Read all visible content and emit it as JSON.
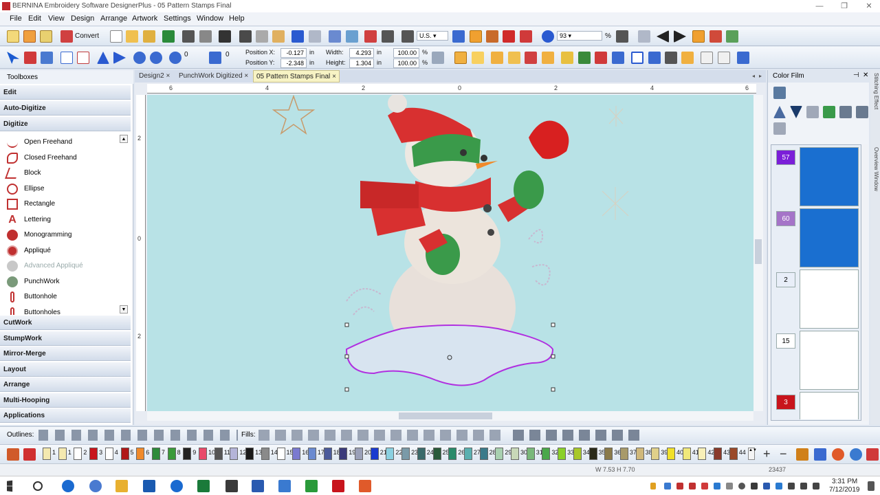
{
  "window": {
    "title": "BERNINA Embroidery Software DesignerPlus - 05 Pattern Stamps Final"
  },
  "menu": [
    "File",
    "Edit",
    "View",
    "Design",
    "Arrange",
    "Artwork",
    "Settings",
    "Window",
    "Help"
  ],
  "toolbar": {
    "convert_label": "Convert",
    "units": "U.S.",
    "zoom": "93",
    "zoom_unit": "%",
    "rotate_value": "0",
    "mirror_value": "0",
    "position_x_label": "Position X:",
    "position_x": "-0.127",
    "position_y_label": "Position Y:",
    "position_y": "-2.348",
    "unit_in": "in",
    "width_label": "Width:",
    "width": "4.293",
    "height_label": "Height:",
    "height": "1.304",
    "scale_x": "100.00",
    "scale_y": "100.00",
    "pct": "%"
  },
  "tabs": [
    {
      "label": "Design2",
      "close": "×"
    },
    {
      "label": "PunchWork Digitized",
      "close": "×"
    },
    {
      "label": "05 Pattern Stamps Final",
      "close": "×"
    }
  ],
  "toolboxes": {
    "title": "Toolboxes",
    "sections_top": [
      "Edit",
      "Auto-Digitize",
      "Digitize"
    ],
    "digitize_items": [
      {
        "label": "Open Freehand",
        "icon": "open-freehand-icon"
      },
      {
        "label": "Closed Freehand",
        "icon": "closed-freehand-icon"
      },
      {
        "label": "Block",
        "icon": "block-icon"
      },
      {
        "label": "Ellipse",
        "icon": "ellipse-icon"
      },
      {
        "label": "Rectangle",
        "icon": "rectangle-icon"
      },
      {
        "label": "Lettering",
        "icon": "lettering-icon"
      },
      {
        "label": "Monogramming",
        "icon": "monogramming-icon"
      },
      {
        "label": "Appliqué",
        "icon": "applique-icon"
      },
      {
        "label": "Advanced Appliqué",
        "icon": "advanced-applique-icon"
      },
      {
        "label": "PunchWork",
        "icon": "punchwork-icon"
      },
      {
        "label": "Buttonhole",
        "icon": "buttonhole-icon"
      },
      {
        "label": "Buttonholes",
        "icon": "buttonholes-icon"
      }
    ],
    "sections_bottom": [
      "CutWork",
      "StumpWork",
      "Mirror-Merge",
      "Layout",
      "Arrange",
      "Multi-Hooping",
      "Applications"
    ]
  },
  "rulers": {
    "h_ticks": [
      "6",
      "4",
      "2",
      "0",
      "2",
      "4",
      "6"
    ],
    "v_ticks": [
      "2",
      "0",
      "2"
    ]
  },
  "colorfilm": {
    "title": "Color Film",
    "side_tabs": [
      "Stitching Effect",
      "Overview Window"
    ],
    "rows": [
      {
        "num": "57",
        "color": "#7b1fd8",
        "thumb": "#1a6fd0"
      },
      {
        "num": "60",
        "color": "#a574c8",
        "thumb": "#1a6fd0"
      },
      {
        "num": "2",
        "color": "#e8eef8",
        "thumb": "#ffffff"
      },
      {
        "num": "15",
        "color": "#ffffff",
        "thumb": "#ffffff"
      },
      {
        "num": "3",
        "color": "#c8141c",
        "thumb": "#ffffff"
      }
    ]
  },
  "bottom": {
    "outlines_label": "Outlines:",
    "fills_label": "Fills:",
    "palette": [
      {
        "n": "1",
        "c": "#f4e9b0"
      },
      {
        "n": "1",
        "c": "#f4e9b0"
      },
      {
        "n": "2",
        "c": "#ffffff"
      },
      {
        "n": "3",
        "c": "#c8141c"
      },
      {
        "n": "4",
        "c": "#ffffff"
      },
      {
        "n": "5",
        "c": "#b01818"
      },
      {
        "n": "6",
        "c": "#f08a2a"
      },
      {
        "n": "7",
        "c": "#2e8b3a"
      },
      {
        "n": "8",
        "c": "#3a9a3a"
      },
      {
        "n": "9",
        "c": "#222222"
      },
      {
        "n": "10",
        "c": "#e84a6a"
      },
      {
        "n": "11",
        "c": "#555555"
      },
      {
        "n": "12",
        "c": "#b4b4d8"
      },
      {
        "n": "13",
        "c": "#1a1a1a"
      },
      {
        "n": "14",
        "c": "#8a8a8a"
      },
      {
        "n": "15",
        "c": "#ffffff"
      },
      {
        "n": "16",
        "c": "#7a7ad0"
      },
      {
        "n": "17",
        "c": "#6a8ad0"
      },
      {
        "n": "18",
        "c": "#4a5a9a"
      },
      {
        "n": "19",
        "c": "#3a3a7a"
      },
      {
        "n": "20",
        "c": "#9aa0b8"
      },
      {
        "n": "21",
        "c": "#1a3acf"
      },
      {
        "n": "22",
        "c": "#8ad0e0"
      },
      {
        "n": "23",
        "c": "#7a9aa8"
      },
      {
        "n": "24",
        "c": "#3a6a6a"
      },
      {
        "n": "25",
        "c": "#2a5a3a"
      },
      {
        "n": "26",
        "c": "#2a8a6a"
      },
      {
        "n": "27",
        "c": "#5ab0b0"
      },
      {
        "n": "28",
        "c": "#3a7a8a"
      },
      {
        "n": "29",
        "c": "#a8d0b0"
      },
      {
        "n": "30",
        "c": "#c8d8b8"
      },
      {
        "n": "31",
        "c": "#7ab87a"
      },
      {
        "n": "32",
        "c": "#4aa84a"
      },
      {
        "n": "33",
        "c": "#8ad02a"
      },
      {
        "n": "34",
        "c": "#a8c82a"
      },
      {
        "n": "35",
        "c": "#2a2a1a"
      },
      {
        "n": "36",
        "c": "#8a7a4a"
      },
      {
        "n": "37",
        "c": "#a89a6a"
      },
      {
        "n": "38",
        "c": "#d0b87a"
      },
      {
        "n": "39",
        "c": "#e0d08a"
      },
      {
        "n": "40",
        "c": "#f0e02a"
      },
      {
        "n": "41",
        "c": "#f0e87a"
      },
      {
        "n": "42",
        "c": "#f8f0b8"
      },
      {
        "n": "43",
        "c": "#8a3a2a"
      },
      {
        "n": "44",
        "c": "#9a4a2a"
      }
    ]
  },
  "status": {
    "dimensions": "W 7.53 H 7.70",
    "stitch_count": "23437"
  },
  "taskbar": {
    "time": "3:31 PM",
    "date": "7/12/2019"
  }
}
